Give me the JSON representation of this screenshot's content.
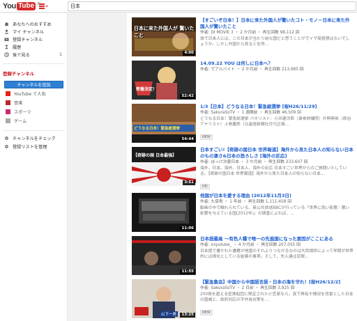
{
  "header": {
    "logo_you": "You",
    "logo_tube": "Tube",
    "logo_region": "JP",
    "search_value": "日本"
  },
  "sidebar": {
    "items": [
      {
        "label": "あなたへのおすすめ",
        "icon": "home-icon"
      },
      {
        "label": "マイ チャンネル",
        "icon": "person-icon"
      },
      {
        "label": "登録チャンネル",
        "icon": "subscriptions-icon"
      },
      {
        "label": "履歴",
        "icon": "history-icon"
      },
      {
        "label": "後で見る",
        "icon": "watch-later-icon",
        "count": "1"
      }
    ],
    "section_title": "登録チャンネル",
    "channel_button": "チャンネルを追加",
    "channels": [
      {
        "label": "YouTube で人気",
        "color": "#e62117"
      },
      {
        "label": "音楽",
        "color": "#b52b2b"
      },
      {
        "label": "スポーツ",
        "color": "#c92b6f"
      },
      {
        "label": "ゲーム",
        "color": "#aaaaaa"
      }
    ],
    "bottom": [
      {
        "label": "チャンネルをチェック",
        "icon": "gear-icon"
      },
      {
        "label": "登録リストを管理",
        "icon": "gear-icon"
      }
    ]
  },
  "results": [
    {
      "title": "【すごいぞ日本！】日本に来た外国人が驚いたコト・モノ－日本に来た外国人が驚いたこと",
      "meta": "作者: DI MOVIE 3 ・ 2 か月前 ・ 再生回数 98,112 回",
      "desc": "旅で日本人には、この日本が当たり前な国だと思うことがでイザ英感想はないでしょうか。しかし外国から見ると全然...",
      "duration": "4:00",
      "thumb_text": "日本に来た外国人が 驚いたこと",
      "badge": ""
    },
    {
      "title": "14.09.22 YOU は何しに日本へ？",
      "meta": "作者: でアルバイト ・ 2 か月前 ・ 再生回数 213,985 回",
      "desc": "",
      "duration": "52:42",
      "thumb_text": "密着決定！",
      "badge": ""
    },
    {
      "title": "1/3【日本】どうなる日本！緊急総選挙 [桜H26/11/29]",
      "meta": "作者: SakuraSoTV ・ 1 週間前 ・ 再生回数 46,509 回",
      "desc": "どうなる日本！緊急総選挙 パネリスト：小浜遺次郎（衆参詳議院）片桐典依（政治アナリスト）上島嘉郎（元産経新聞社月刊正論...",
      "duration": "54:44",
      "thumb_text": "どうなる日本！緊急総選挙",
      "badge": "NEW"
    },
    {
      "title": "日本すごい!【奇跡の国日本 世界報道】海外から見た日本人の知らない日本のもの凄さ&日本の恐ろしさ [海外の反応]",
      "meta": "作者: ぼっけ渋夏日本 ・ 3 か月前 ・ 再生回数 233,607 回",
      "desc": "海外、日本、海外、日本人、海外の反応 日本すごい世界からのご質問いたしている。【奇跡の国日本 世界報道】海外から見た日本人の知らない日本...",
      "duration": "3:51",
      "thumb_text": "【奇跡の国 日本最強】",
      "badge": "HD"
    },
    {
      "title": "他国が日本を愛する理由 (2012年11月3日)",
      "meta": "作者: 久保秀 ・ 1 年前 ・ 再生回数 1,111,458 回",
      "desc": "動画の中で触れられている、英公共放送BBCが行っている「世界に良い影響／悪い影響を与えている国(2012年)」の調査によれば、...",
      "duration": "11:06",
      "thumb_text": "",
      "badge": ""
    },
    {
      "title": "日本語最高 ～有色人種で唯一の先進国になった要因がここにある",
      "meta": "作者: xxyutube_ ・ 4 か月前 ・ 再生回数 207,055 回",
      "desc": "日本語で書かれた書籍が他国のそれよりつながるなのは大同誤訳によって学問が世界的には様化としている結果の事実。そして、先人達は尼眼...",
      "duration": "11:55",
      "thumb_text": "",
      "badge": ""
    },
    {
      "title": "【緊急集会】中国から中国語言語・日本の海を守れ！[桜H26/12/2]",
      "meta": "作者: SakuraSoTV ・ 2 日前 ・ 再生回数 3,925 回",
      "desc": "200発を超える密漁船団に限定された小笠原なら。真下昇有や情況を背景とした日本の国威と、政府対応の不作為対策を...",
      "duration": "13:25",
      "thumb_text": "山下一男",
      "badge": "NEW"
    }
  ],
  "colors": {
    "link": "#1b5ccf",
    "brand_red": "#d52a2a",
    "accent_blue": "#2f7fd3"
  }
}
